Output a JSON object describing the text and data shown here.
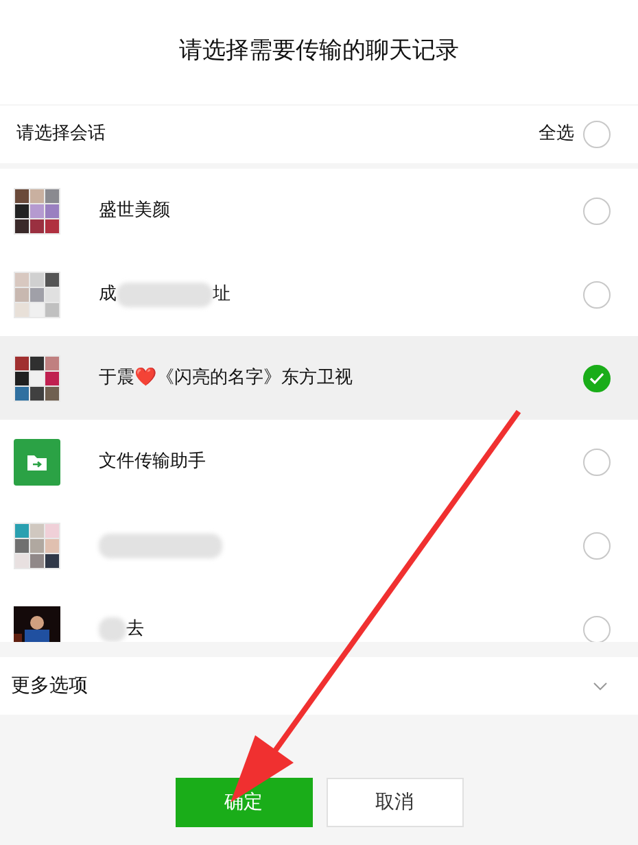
{
  "dialog": {
    "title": "请选择需要传输的聊天记录"
  },
  "header": {
    "label": "请选择会话",
    "select_all": "全选",
    "all_checked": false
  },
  "chats": [
    {
      "kind": "group",
      "name": "盛世美颜",
      "blurred": false,
      "checked": false
    },
    {
      "kind": "group",
      "name": "成",
      "name_end": "址",
      "blurred": true,
      "checked": false
    },
    {
      "kind": "group",
      "name": "于震❤️《闪亮的名字》东方卫视",
      "blurred": false,
      "checked": true
    },
    {
      "kind": "file",
      "name": "文件传输助手",
      "blurred": false,
      "checked": false
    },
    {
      "kind": "group",
      "blurred": true,
      "checked": false
    },
    {
      "name": "去",
      "blurred": true,
      "checked": false
    }
  ],
  "more_options": {
    "label": "更多选项",
    "expanded": false
  },
  "buttons": [
    {
      "kind": "primary",
      "label": "确定"
    },
    {
      "kind": "secondary",
      "label": "取消"
    }
  ],
  "annotation": {
    "kind": "arrow"
  }
}
